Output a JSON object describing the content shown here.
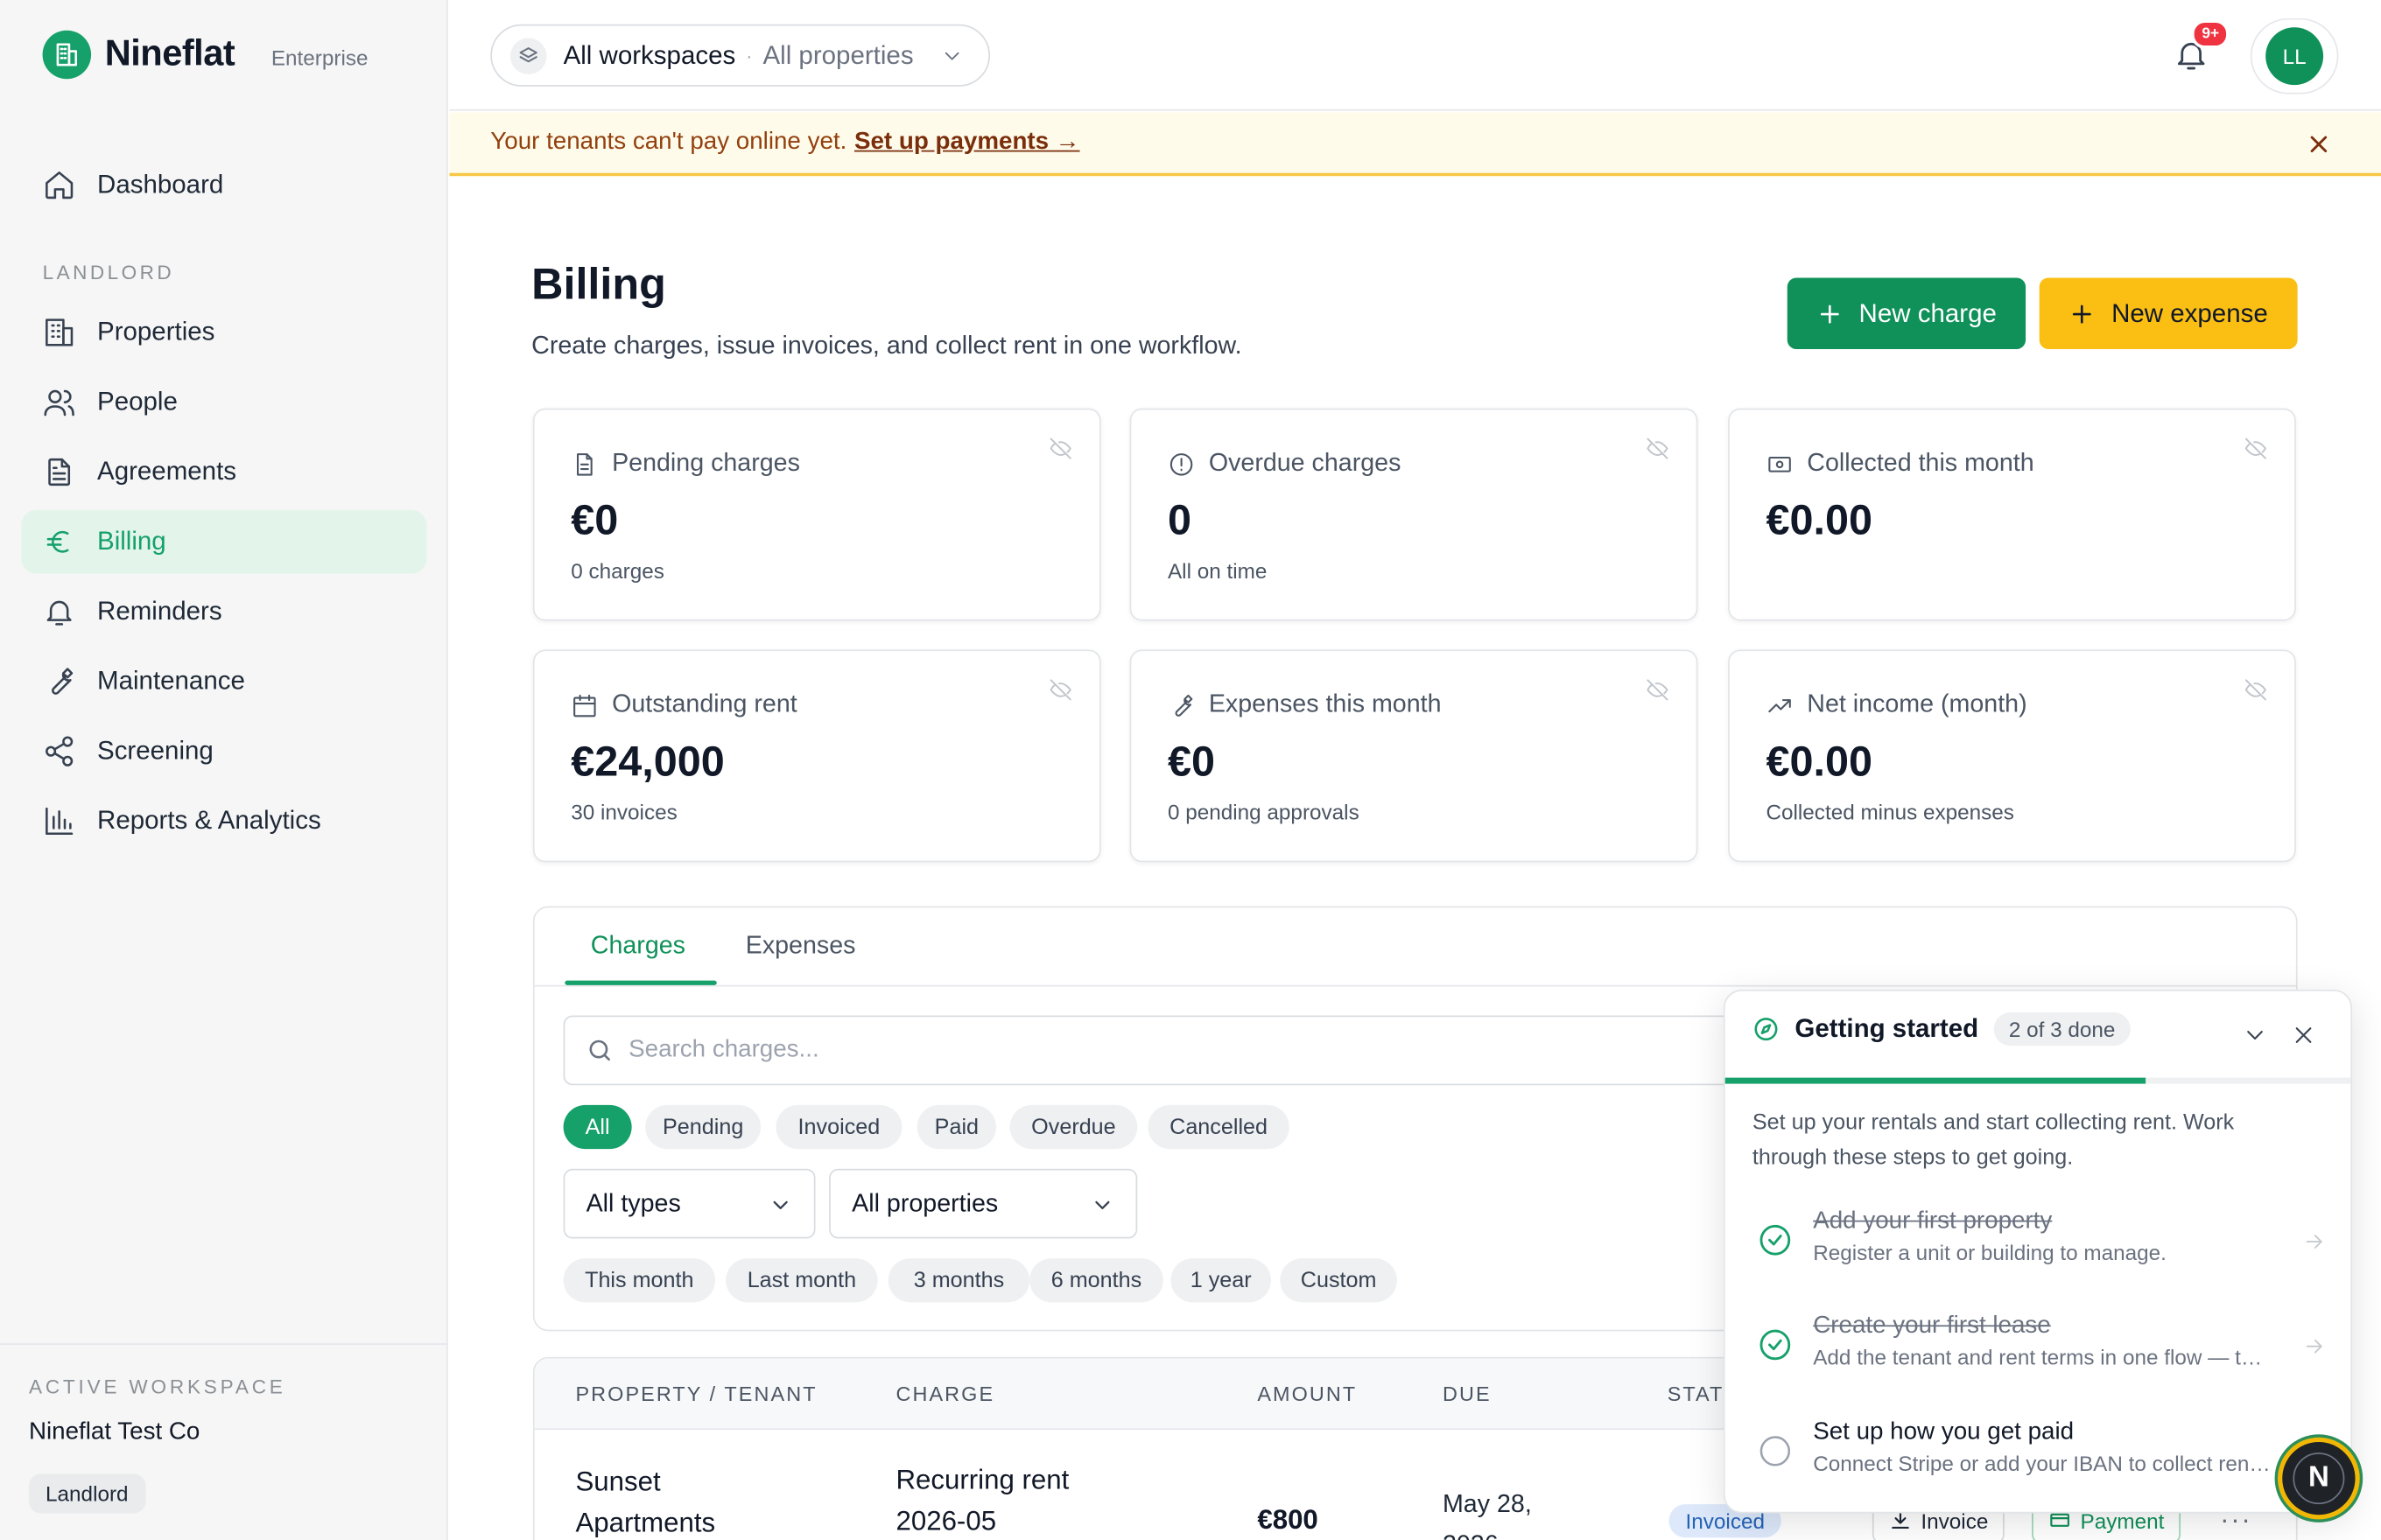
{
  "brand": {
    "name": "Nineflat",
    "tier": "Enterprise"
  },
  "sidebar": {
    "dashboard": "Dashboard",
    "section_label": "LANDLORD",
    "items": [
      {
        "label": "Properties",
        "icon": "building-icon"
      },
      {
        "label": "People",
        "icon": "people-icon"
      },
      {
        "label": "Agreements",
        "icon": "document-icon"
      },
      {
        "label": "Billing",
        "icon": "euro-icon",
        "active": true
      },
      {
        "label": "Reminders",
        "icon": "bell-icon"
      },
      {
        "label": "Maintenance",
        "icon": "wrench-icon"
      },
      {
        "label": "Screening",
        "icon": "share-icon"
      },
      {
        "label": "Reports & Analytics",
        "icon": "bar-chart-icon"
      }
    ],
    "workspace": {
      "label": "ACTIVE WORKSPACE",
      "name": "Nineflat Test Co",
      "role": "Landlord"
    }
  },
  "topbar": {
    "workspace": "All workspaces",
    "separator": "·",
    "property": "All properties",
    "notif_badge": "9+",
    "avatar_initials": "LL"
  },
  "banner": {
    "text": "Your tenants can't pay online yet.",
    "link": "Set up payments →"
  },
  "page": {
    "title": "Billing",
    "subtitle": "Create charges, issue invoices, and collect rent in one workflow.",
    "new_charge": "New charge",
    "new_expense": "New expense"
  },
  "cards": [
    {
      "label": "Pending charges",
      "value": "€0",
      "note": "0 charges"
    },
    {
      "label": "Overdue charges",
      "value": "0",
      "note": "All on time"
    },
    {
      "label": "Collected this month",
      "value": "€0.00",
      "note": ""
    },
    {
      "label": "Outstanding rent",
      "value": "€24,000",
      "note": "30 invoices"
    },
    {
      "label": "Expenses this month",
      "value": "€0",
      "note": "0 pending approvals"
    },
    {
      "label": "Net income (month)",
      "value": "€0.00",
      "note": "Collected minus expenses"
    }
  ],
  "charges": {
    "tabs": [
      "Charges",
      "Expenses"
    ],
    "search_placeholder": "Search charges...",
    "status_filters": [
      "All",
      "Pending",
      "Invoiced",
      "Paid",
      "Overdue",
      "Cancelled"
    ],
    "type_select": "All types",
    "property_select": "All properties",
    "periods": [
      "This month",
      "Last month",
      "3 months",
      "6 months",
      "1 year",
      "Custom"
    ]
  },
  "table": {
    "headers": [
      "PROPERTY / TENANT",
      "CHARGE",
      "AMOUNT",
      "DUE",
      "STAT"
    ],
    "row": {
      "property_line1": "Sunset",
      "property_line2": "Apartments",
      "charge_line1": "Recurring rent",
      "charge_line2": "2026-05",
      "amount": "€800",
      "due_line1": "May 28,",
      "due_line2": "2026",
      "status": "Invoiced",
      "invoice_btn": "Invoice",
      "payment_btn": "Payment",
      "more": "···"
    }
  },
  "getting_started": {
    "title": "Getting started",
    "progress": "2 of 3 done",
    "progress_fraction": 0.67,
    "description": "Set up your rentals and start collecting rent. Work through these steps to get going.",
    "steps": [
      {
        "title": "Add your first property",
        "desc": "Register a unit or building to manage.",
        "done": true
      },
      {
        "title": "Create your first lease",
        "desc": "Add the tenant and rent terms in one flow — then invoices follow automatically.",
        "done": true
      },
      {
        "title": "Set up how you get paid",
        "desc": "Connect Stripe or add your IBAN to collect rent from tenants.",
        "done": false
      }
    ]
  },
  "fab": {
    "letter": "N"
  },
  "colors": {
    "brand": "#16a06a",
    "accent": "#fbbf14",
    "danger": "#ef3340"
  }
}
